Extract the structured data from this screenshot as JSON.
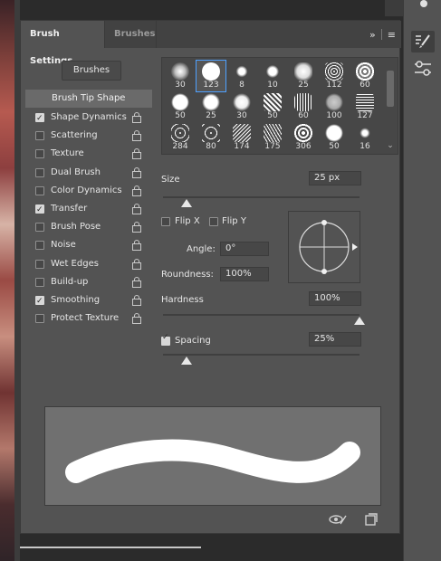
{
  "tabs": [
    {
      "label": "Brush Settings"
    },
    {
      "label": "Brushes"
    }
  ],
  "header_icons": {
    "collapse": "»",
    "menu": "≡"
  },
  "left": {
    "brushes_button": "Brushes",
    "tip_shape": "Brush Tip Shape",
    "options": [
      {
        "label": "Shape Dynamics",
        "checked": true
      },
      {
        "label": "Scattering",
        "checked": false
      },
      {
        "label": "Texture",
        "checked": false
      },
      {
        "label": "Dual Brush",
        "checked": false
      },
      {
        "label": "Color Dynamics",
        "checked": false
      },
      {
        "label": "Transfer",
        "checked": true
      },
      {
        "label": "Brush Pose",
        "checked": false
      },
      {
        "label": "Noise",
        "checked": false
      },
      {
        "label": "Wet Edges",
        "checked": false
      },
      {
        "label": "Build-up",
        "checked": false
      },
      {
        "label": "Smoothing",
        "checked": true
      },
      {
        "label": "Protect Texture",
        "checked": false
      }
    ]
  },
  "presets": [
    {
      "num": "30",
      "selected": false
    },
    {
      "num": "123",
      "selected": true
    },
    {
      "num": "8",
      "selected": false
    },
    {
      "num": "10",
      "selected": false
    },
    {
      "num": "25",
      "selected": false
    },
    {
      "num": "112",
      "selected": false
    },
    {
      "num": "60",
      "selected": false
    },
    {
      "num": "50",
      "selected": false
    },
    {
      "num": "25",
      "selected": false
    },
    {
      "num": "30",
      "selected": false
    },
    {
      "num": "50",
      "selected": false
    },
    {
      "num": "60",
      "selected": false
    },
    {
      "num": "100",
      "selected": false
    },
    {
      "num": "127",
      "selected": false
    },
    {
      "num": "284",
      "selected": false
    },
    {
      "num": "80",
      "selected": false
    },
    {
      "num": "174",
      "selected": false
    },
    {
      "num": "175",
      "selected": false
    },
    {
      "num": "306",
      "selected": false
    },
    {
      "num": "50",
      "selected": false
    },
    {
      "num": "16",
      "selected": false
    }
  ],
  "size": {
    "label": "Size",
    "value": "25 px",
    "slider": 0.12
  },
  "flip": {
    "x_label": "Flip X",
    "y_label": "Flip Y",
    "x_checked": false,
    "y_checked": false
  },
  "angle": {
    "label": "Angle:",
    "value": "0°"
  },
  "roundness": {
    "label": "Roundness:",
    "value": "100%"
  },
  "hardness": {
    "label": "Hardness",
    "value": "100%",
    "slider": 1.0
  },
  "spacing": {
    "label": "Spacing",
    "value": "25%",
    "checked": true,
    "slider": 0.12
  }
}
